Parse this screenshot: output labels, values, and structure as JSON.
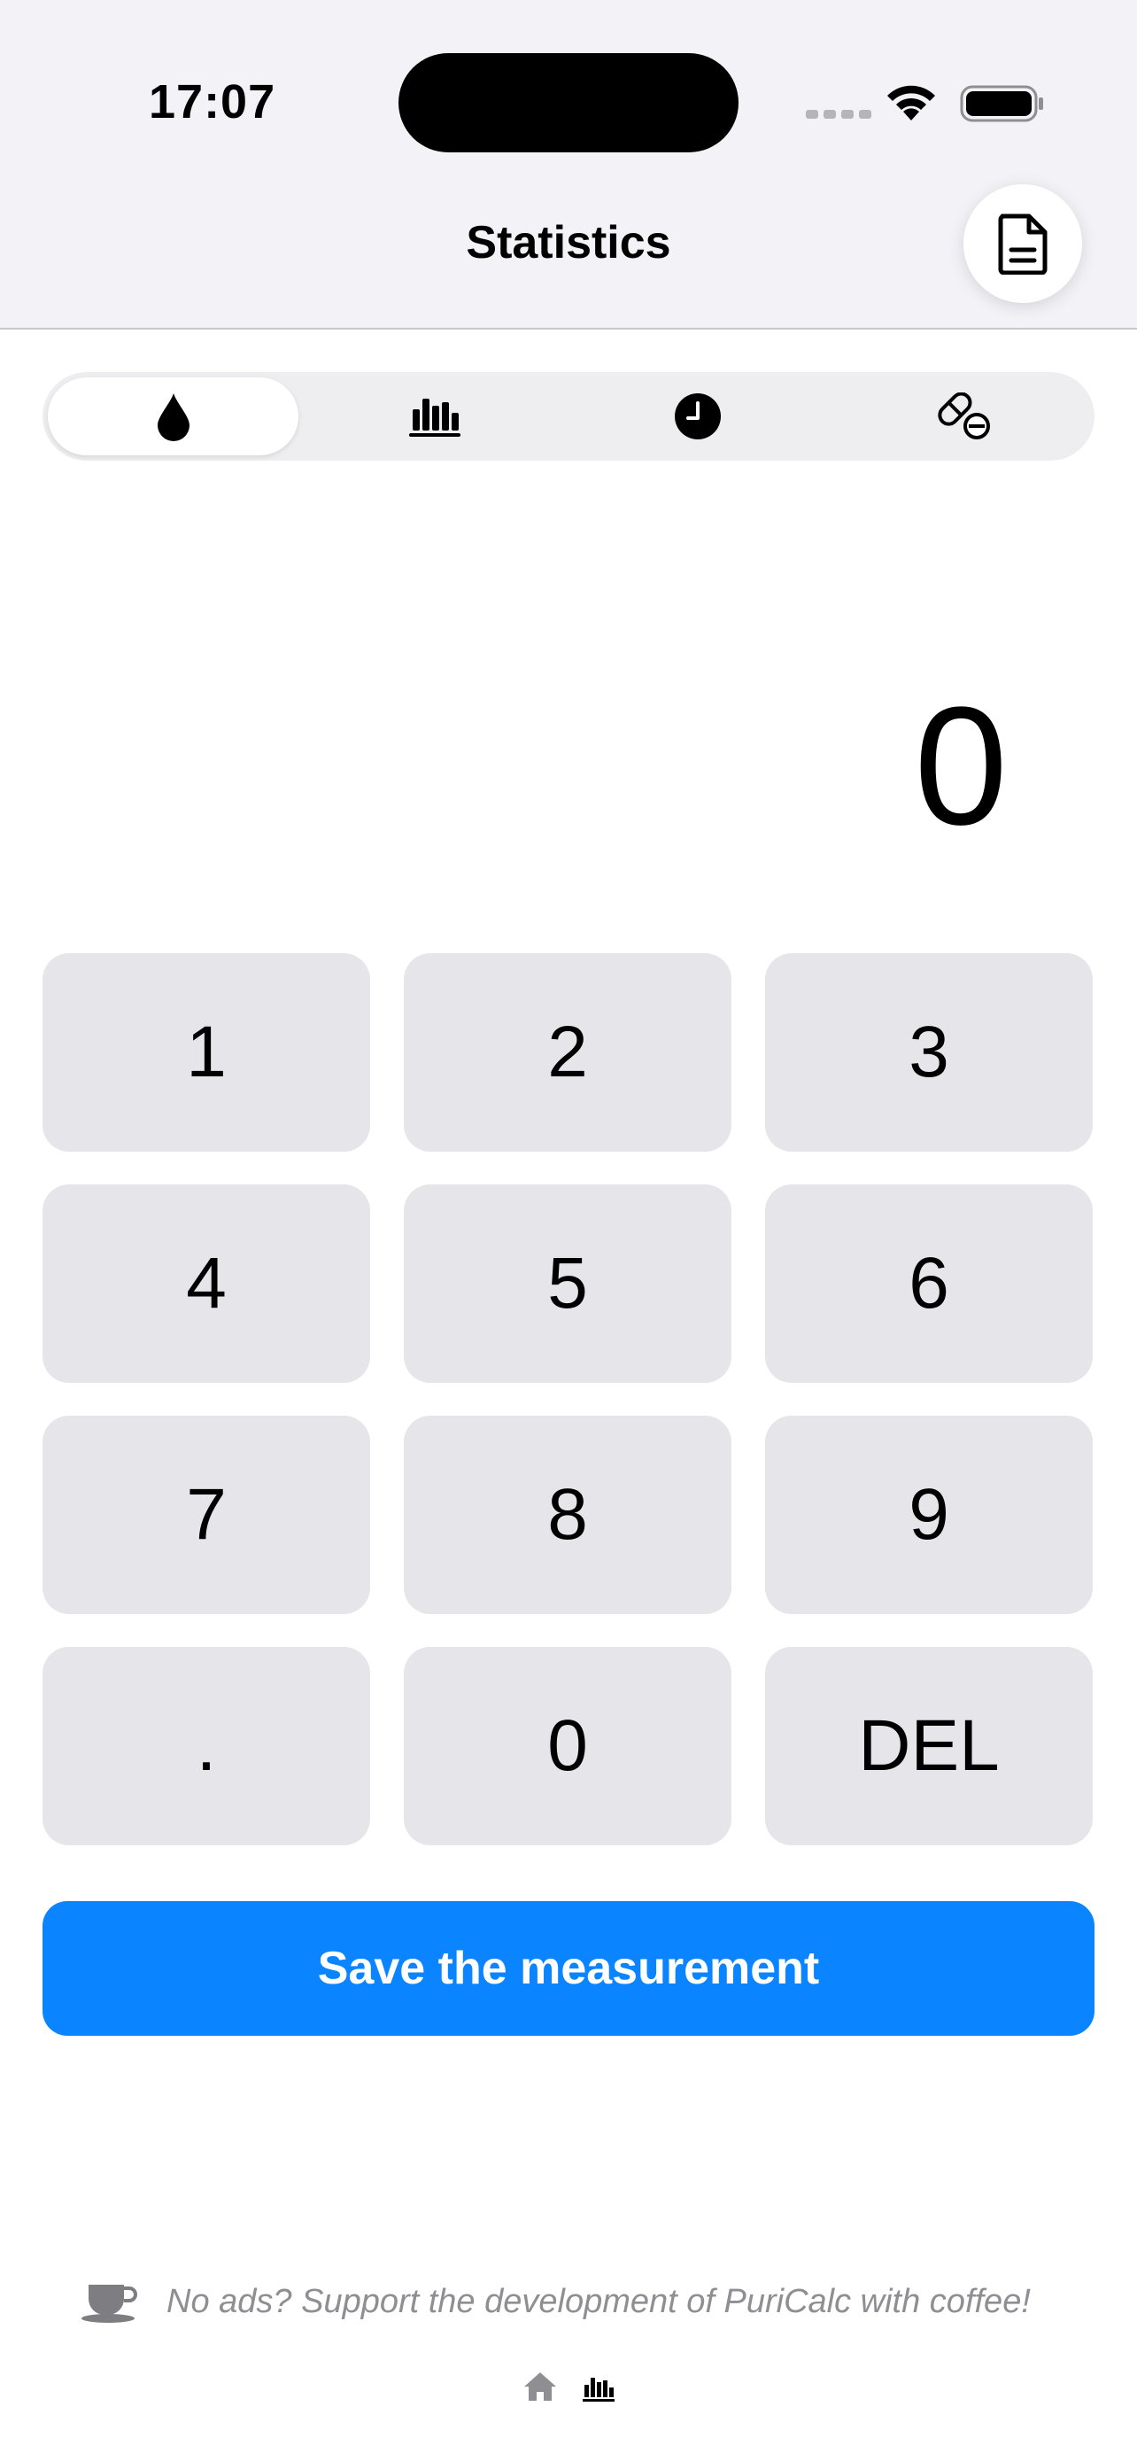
{
  "status_bar": {
    "time": "17:07"
  },
  "header": {
    "title": "Statistics",
    "action_icon": "document-icon"
  },
  "segments": [
    {
      "icon": "drop-icon",
      "active": true
    },
    {
      "icon": "bar-chart-icon",
      "active": false
    },
    {
      "icon": "clock-icon",
      "active": false
    },
    {
      "icon": "pill-icon",
      "active": false
    }
  ],
  "display": {
    "value": "0"
  },
  "keypad": {
    "keys": [
      "1",
      "2",
      "3",
      "4",
      "5",
      "6",
      "7",
      "8",
      "9",
      ".",
      "0",
      "DEL"
    ]
  },
  "save_button": {
    "label": "Save the measurement"
  },
  "support": {
    "text": "No ads? Support the development of PuriCalc with coffee!",
    "icon": "coffee-cup-icon"
  },
  "bottom_icons": [
    "home-icon",
    "bar-chart-icon"
  ],
  "colors": {
    "accent": "#0a84ff",
    "key_bg": "#e5e5ea",
    "header_bg": "#f2f2f7"
  }
}
